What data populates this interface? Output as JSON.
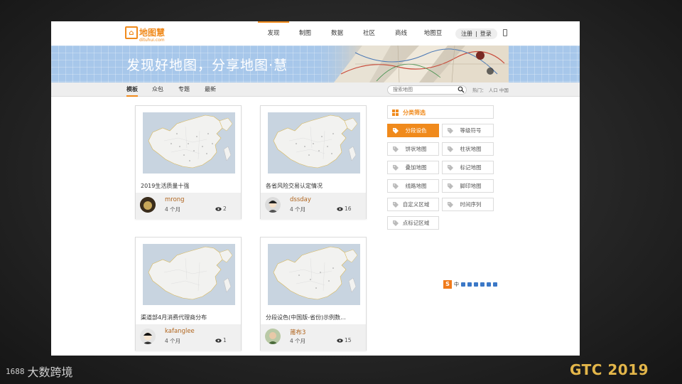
{
  "nav": {
    "logo_text": "地图慧",
    "logo_sub": "dituhui.com",
    "links": [
      "发现",
      "制图",
      "数据",
      "社区",
      "商线",
      "地图豆"
    ],
    "register": "注册",
    "separator": "|",
    "login": "登录"
  },
  "banner": {
    "title": "发现好地图，分享地图·慧"
  },
  "subnav": {
    "tabs": [
      "模板",
      "众包",
      "专题",
      "最新"
    ],
    "search_placeholder": "搜索地图",
    "hot": "热门：　人口  中国"
  },
  "cards": [
    {
      "title": "2019生活质量十强",
      "author": "mrong",
      "ago": "4 个月",
      "views": "2"
    },
    {
      "title": "各省风险交易认定情况",
      "author": "dssday",
      "ago": "4 个月",
      "views": "16"
    },
    {
      "title": "渠道部4月消费代理商分布",
      "author": "kafanglee",
      "ago": "4 个月",
      "views": "1"
    },
    {
      "title": "分段设色(中国版-省份)示例数...",
      "author": "莆布3",
      "ago": "4 个月",
      "views": "15"
    }
  ],
  "filter": {
    "title": "分类筛选",
    "buttons": [
      "分段设色",
      "等级符号",
      "饼状地图",
      "柱状地图",
      "叠加地图",
      "标记地图",
      "线路地图",
      "脚印地图",
      "自定义区域",
      "时间序列",
      "点标记区域"
    ]
  },
  "ime": {
    "logo": "S",
    "mode": "中"
  },
  "watermarks": {
    "left_logo": "1688",
    "left_text": "大数跨境",
    "right": "GTC 2019"
  },
  "colors": {
    "accent": "#f08a1c",
    "banner": "#a7c7ea",
    "map_sea": "#c8d4e0",
    "map_land": "#f2f2f0"
  }
}
